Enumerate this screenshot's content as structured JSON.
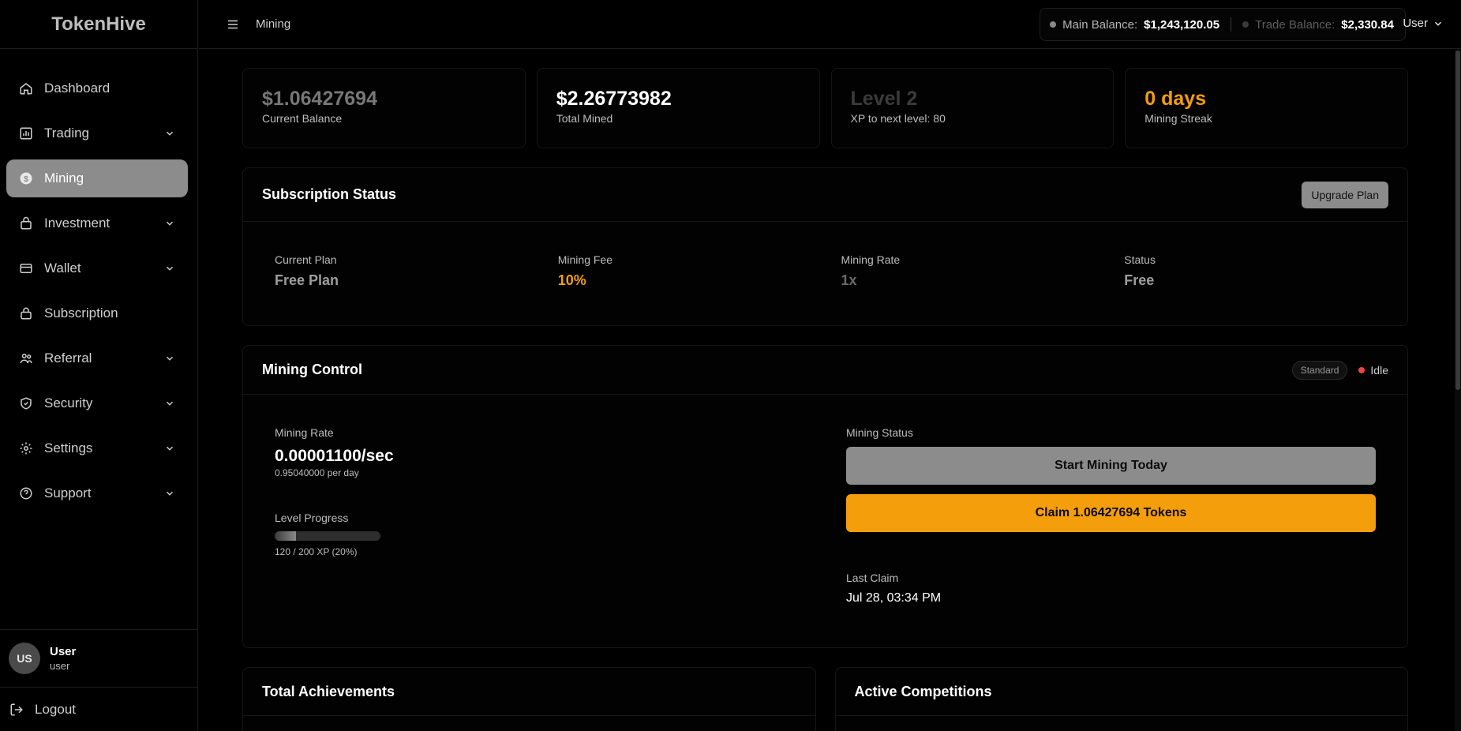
{
  "app": {
    "brand": "TokenHive"
  },
  "sidebar": {
    "items": [
      {
        "label": "Dashboard"
      },
      {
        "label": "Trading"
      },
      {
        "label": "Mining"
      },
      {
        "label": "Investment"
      },
      {
        "label": "Wallet"
      },
      {
        "label": "Subscription"
      },
      {
        "label": "Referral"
      },
      {
        "label": "Security"
      },
      {
        "label": "Settings"
      },
      {
        "label": "Support"
      }
    ],
    "user": {
      "initials": "US",
      "name": "User",
      "role": "user"
    },
    "logout_label": "Logout"
  },
  "header": {
    "breadcrumb": "Mining",
    "main_balance_label": "Main Balance:",
    "main_balance_value": "$1,243,120.05",
    "trade_balance_label": "Trade Balance:",
    "trade_balance_value": "$2,330.84",
    "user_menu_label": "User"
  },
  "stats": [
    {
      "value": "$1.06427694",
      "label": "Current Balance"
    },
    {
      "value": "$2.26773982",
      "label": "Total Mined"
    },
    {
      "value": "Level 2",
      "label": "XP to next level: 80"
    },
    {
      "value": "0 days",
      "label": "Mining Streak"
    }
  ],
  "subscription": {
    "title": "Subscription Status",
    "upgrade_label": "Upgrade Plan",
    "fields": [
      {
        "label": "Current Plan",
        "value": "Free Plan"
      },
      {
        "label": "Mining Fee",
        "value": "10%"
      },
      {
        "label": "Mining Rate",
        "value": "1x"
      },
      {
        "label": "Status",
        "value": "Free"
      }
    ]
  },
  "mining_control": {
    "title": "Mining Control",
    "badge": "Standard",
    "status": "Idle",
    "rate_label": "Mining Rate",
    "rate_value": "0.00001100/sec",
    "rate_per_day": "0.95040000 per day",
    "level_label": "Level Progress",
    "level_progress_fraction": 0.2,
    "level_text": "120 / 200 XP (20%)",
    "status_label": "Mining Status",
    "start_button": "Start Mining Today",
    "claim_button": "Claim 1.06427694 Tokens",
    "last_claim_label": "Last Claim",
    "last_claim_value": "Jul 28, 03:34 PM"
  },
  "bottom": {
    "achievements_title": "Total Achievements",
    "competitions_title": "Active Competitions"
  },
  "colors": {
    "accent": "#f59e0b",
    "active_nav": "#8c8c8c",
    "idle_dot": "#ef4444"
  }
}
